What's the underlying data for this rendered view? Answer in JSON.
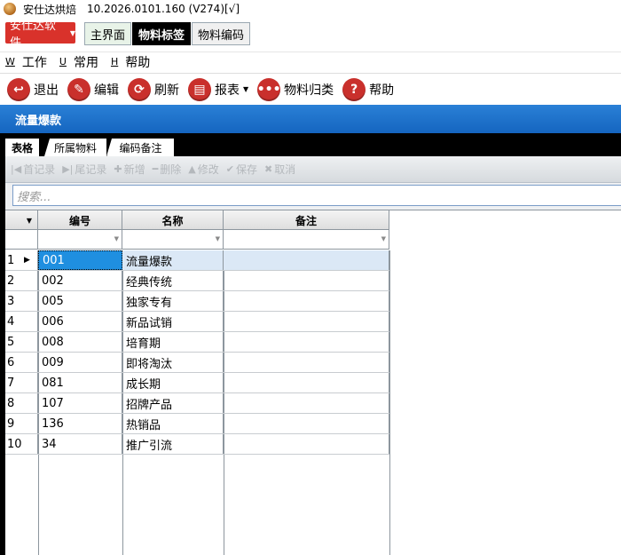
{
  "titlebar": {
    "app_name": "安仕达烘焙",
    "version": "10.2026.0101.160 (V274)[√]"
  },
  "brand_button": {
    "label": "安仕达软件"
  },
  "module_tabs": [
    {
      "label": "主界面"
    },
    {
      "label": "物料标签"
    },
    {
      "label": "物料编码"
    }
  ],
  "menus": [
    {
      "key": "W",
      "label": "工作"
    },
    {
      "key": "U",
      "label": "常用"
    },
    {
      "key": "H",
      "label": "帮助"
    }
  ],
  "toolbar": {
    "exit": "退出",
    "edit": "编辑",
    "refresh": "刷新",
    "report": "报表",
    "classify": "物料归类",
    "help": "帮助"
  },
  "panel": {
    "title": "流量爆款"
  },
  "sub_tabs": [
    {
      "label": "表格"
    },
    {
      "label": "所属物料"
    },
    {
      "label": "编码备注"
    }
  ],
  "nav": {
    "first": "首记录",
    "last": "尾记录",
    "add": "新增",
    "delete": "删除",
    "modify": "修改",
    "save": "保存",
    "cancel": "取消"
  },
  "search": {
    "placeholder": "搜索..."
  },
  "grid": {
    "columns": [
      "编号",
      "名称",
      "备注"
    ],
    "rows": [
      {
        "n": "1",
        "code": "001",
        "name": "流量爆款",
        "note": ""
      },
      {
        "n": "2",
        "code": "002",
        "name": "经典传统",
        "note": ""
      },
      {
        "n": "3",
        "code": "005",
        "name": "独家专有",
        "note": ""
      },
      {
        "n": "4",
        "code": "006",
        "name": "新品试销",
        "note": ""
      },
      {
        "n": "5",
        "code": "008",
        "name": "培育期",
        "note": ""
      },
      {
        "n": "6",
        "code": "009",
        "name": "即将淘汰",
        "note": ""
      },
      {
        "n": "7",
        "code": "081",
        "name": "成长期",
        "note": ""
      },
      {
        "n": "8",
        "code": "107",
        "name": "招牌产品",
        "note": ""
      },
      {
        "n": "9",
        "code": "136",
        "name": "热销品",
        "note": ""
      },
      {
        "n": "10",
        "code": "34",
        "name": "推广引流",
        "note": ""
      }
    ],
    "selected_row": 1
  },
  "colors": {
    "brand_red": "#d9322b",
    "panel_blue": "#1e73c8",
    "selection_blue": "#1f8fe0"
  }
}
